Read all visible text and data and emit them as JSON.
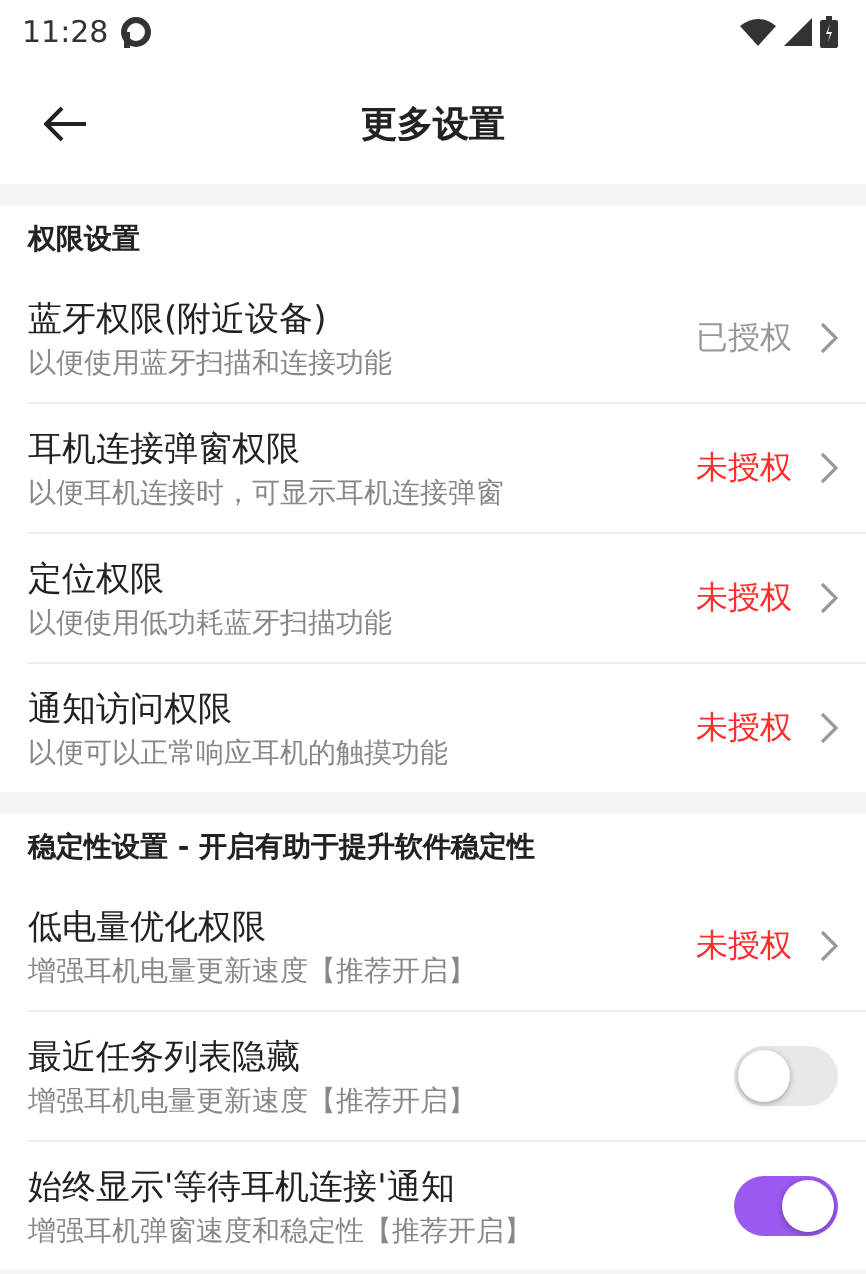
{
  "status_bar": {
    "time": "11:28"
  },
  "app_bar": {
    "title": "更多设置"
  },
  "sections": [
    {
      "title": "权限设置",
      "rows": [
        {
          "kind": "link",
          "title": "蓝牙权限(附近设备)",
          "subtitle": "以便使用蓝牙扫描和连接功能",
          "status": "已授权",
          "granted": true
        },
        {
          "kind": "link",
          "title": "耳机连接弹窗权限",
          "subtitle": "以便耳机连接时，可显示耳机连接弹窗",
          "status": "未授权",
          "granted": false
        },
        {
          "kind": "link",
          "title": "定位权限",
          "subtitle": "以便使用低功耗蓝牙扫描功能",
          "status": "未授权",
          "granted": false
        },
        {
          "kind": "link",
          "title": "通知访问权限",
          "subtitle": "以便可以正常响应耳机的触摸功能",
          "status": "未授权",
          "granted": false
        }
      ]
    },
    {
      "title": "稳定性设置 - 开启有助于提升软件稳定性",
      "rows": [
        {
          "kind": "link",
          "title": "低电量优化权限",
          "subtitle": "增强耳机电量更新速度【推荐开启】",
          "status": "未授权",
          "granted": false
        },
        {
          "kind": "toggle",
          "title": "最近任务列表隐藏",
          "subtitle": "增强耳机电量更新速度【推荐开启】",
          "on": false
        },
        {
          "kind": "toggle",
          "title": "始终显示'等待耳机连接'通知",
          "subtitle": "增强耳机弹窗速度和稳定性【推荐开启】",
          "on": true
        }
      ]
    }
  ]
}
